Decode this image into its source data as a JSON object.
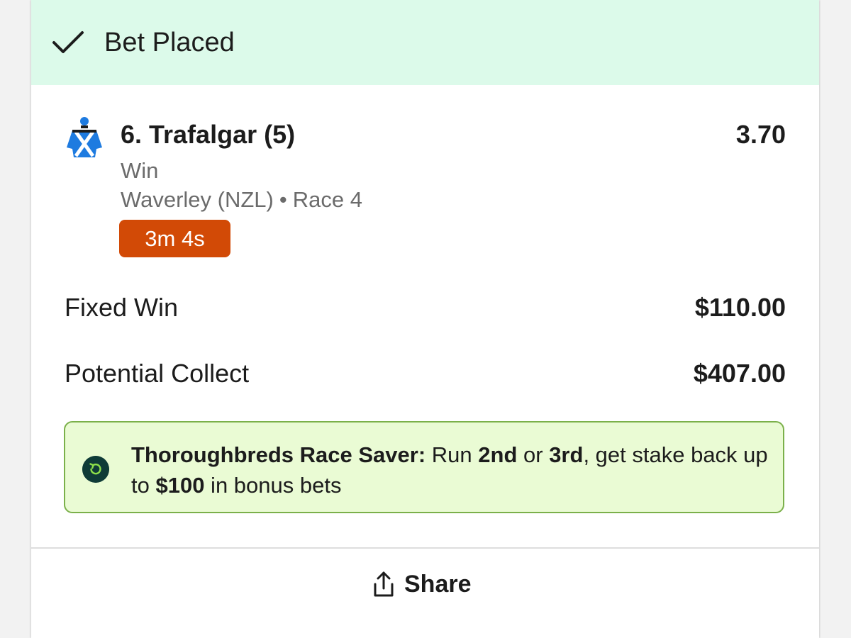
{
  "banner": {
    "title": "Bet Placed",
    "icon": "checkmark-icon",
    "background": "#dcfaea"
  },
  "selection": {
    "runner": "6. Trafalgar (5)",
    "odds": "3.70",
    "bet_type": "Win",
    "venue": "Waverley (NZL)",
    "separator": "•",
    "race": "Race 4",
    "countdown": "3m 4s",
    "countdown_color": "#d24a06",
    "silks_icon": "jockey-silks-icon"
  },
  "summary": {
    "stake_label": "Fixed Win",
    "stake_value": "$110.00",
    "collect_label": "Potential Collect",
    "collect_value": "$407.00"
  },
  "promo": {
    "icon": "refresh-icon",
    "title": "Thoroughbreds Race Saver:",
    "text_1": " Run ",
    "pos_1": "2nd",
    "text_2": " or ",
    "pos_2": "3rd",
    "text_3": ", get stake back up to ",
    "amount": "$100",
    "text_4": " in bonus bets",
    "border_color": "#7bb04a",
    "background": "#eafbd4"
  },
  "actions": {
    "share_label": "Share",
    "share_icon": "share-icon"
  }
}
